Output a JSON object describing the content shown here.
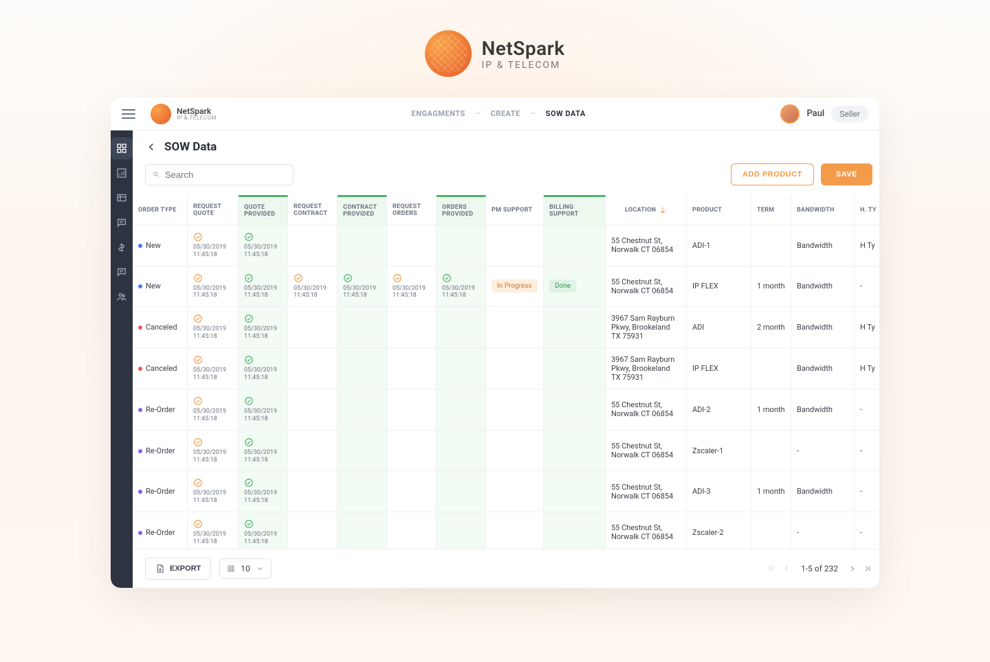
{
  "brand": {
    "name": "NetSpark",
    "sub": "IP & TELECOM"
  },
  "topbar": {
    "breadcrumb": [
      "ENGAGMENTS",
      "CREATE",
      "SOW DATA"
    ],
    "user": {
      "name": "Paul",
      "role": "Seller"
    }
  },
  "sidebar": {
    "items": [
      {
        "name": "dashboard",
        "active": true
      },
      {
        "name": "analytics",
        "active": false
      },
      {
        "name": "tables",
        "active": false
      },
      {
        "name": "messages",
        "active": false
      },
      {
        "name": "billing",
        "active": false
      },
      {
        "name": "chat",
        "active": false
      },
      {
        "name": "users",
        "active": false
      }
    ]
  },
  "page": {
    "title": "SOW Data",
    "search_placeholder": "Search",
    "add_product": "ADD PRODUCT",
    "save": "SAVE"
  },
  "columns": [
    "ORDER TYPE",
    "REQUEST QUOTE",
    "QUOTE PROVIDED",
    "REQUEST CONTRACT",
    "CONTRACT PROVIDED",
    "REQUEST ORDERS",
    "ORDERS PROVIDED",
    "PM SUPPORT",
    "BILLING SUPPORT",
    "LOCATION",
    "PRODUCT",
    "TERM",
    "BANDWIDTH",
    "H. Ty"
  ],
  "tinted_cols": [
    2,
    4,
    6,
    8
  ],
  "timestamp": "05/30/2019 11:45:18",
  "rows": [
    {
      "order_type": "New",
      "dot": "new",
      "cells": [
        "orange",
        "green",
        "",
        "",
        "",
        "",
        "",
        ""
      ],
      "location": "55 Chestnut St, Norwalk CT 06854",
      "product": "ADI-1",
      "term": "",
      "bandwidth": "Bandwidth",
      "ht": "H Ty"
    },
    {
      "order_type": "New",
      "dot": "new",
      "cells": [
        "orange",
        "green",
        "orange",
        "green",
        "orange",
        "green",
        "",
        ""
      ],
      "pm_support": "In Progress",
      "billing_support": "Done",
      "location": "55 Chestnut St, Norwalk CT 06854",
      "product": "IP FLEX",
      "term": "1 month",
      "bandwidth": "Bandwidth",
      "ht": "-"
    },
    {
      "order_type": "Canceled",
      "dot": "canceled",
      "cells": [
        "orange",
        "green",
        "",
        "",
        "",
        "",
        "",
        ""
      ],
      "location": "3967 Sam Rayburn Pkwy, Brookeland TX 75931",
      "product": "ADI",
      "term": "2 month",
      "bandwidth": "Bandwidth",
      "ht": "H Ty"
    },
    {
      "order_type": "Canceled",
      "dot": "canceled",
      "cells": [
        "orange",
        "green",
        "",
        "",
        "",
        "",
        "",
        ""
      ],
      "location": "3967 Sam Rayburn Pkwy, Brookeland TX 75931",
      "product": "IP FLEX",
      "term": "",
      "bandwidth": "Bandwidth",
      "ht": "H Ty"
    },
    {
      "order_type": "Re-Order",
      "dot": "reorder",
      "cells": [
        "orange",
        "green",
        "",
        "",
        "",
        "",
        "",
        ""
      ],
      "location": "55 Chestnut St, Norwalk CT 06854",
      "product": "ADI-2",
      "term": "1 month",
      "bandwidth": "Bandwidth",
      "ht": "-"
    },
    {
      "order_type": "Re-Order",
      "dot": "reorder",
      "cells": [
        "orange",
        "green",
        "",
        "",
        "",
        "",
        "",
        ""
      ],
      "location": "55 Chestnut St, Norwalk CT 06854",
      "product": "Zscaler-1",
      "term": "",
      "bandwidth": "-",
      "ht": "-"
    },
    {
      "order_type": "Re-Order",
      "dot": "reorder",
      "cells": [
        "orange",
        "green",
        "",
        "",
        "",
        "",
        "",
        ""
      ],
      "location": "55 Chestnut St, Norwalk CT 06854",
      "product": "ADI-3",
      "term": "1 month",
      "bandwidth": "Bandwidth",
      "ht": "-"
    },
    {
      "order_type": "Re-Order",
      "dot": "reorder",
      "cells": [
        "orange",
        "green",
        "",
        "",
        "",
        "",
        "",
        ""
      ],
      "location": "55 Chestnut St, Norwalk CT 06854",
      "product": "Zscaler-2",
      "term": "",
      "bandwidth": "-",
      "ht": "-"
    }
  ],
  "footer": {
    "export": "EXPORT",
    "page_size": "10",
    "pager_info": "1-5 of 232"
  }
}
